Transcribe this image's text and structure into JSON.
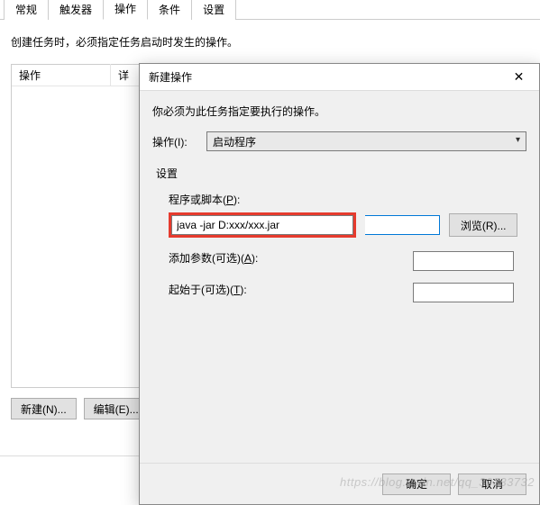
{
  "bgWindow": {
    "tabs": [
      "常规",
      "触发器",
      "操作",
      "条件",
      "设置"
    ],
    "activeTab": 2,
    "desc": "创建任务时，必须指定任务启动时发生的操作。",
    "listHeader": {
      "col1": "操作",
      "col2": "详"
    },
    "buttons": {
      "new": "新建(N)...",
      "edit": "编辑(E)..."
    }
  },
  "dialog": {
    "title": "新建操作",
    "desc": "你必须为此任务指定要执行的操作。",
    "actionLabel": "操作(I):",
    "actionValue": "启动程序",
    "settingsLabel": "设置",
    "progLabelPrefix": "程序或脚本(",
    "progLabelKey": "P",
    "progLabelSuffix": "):",
    "progValue": "java -jar D:xxx/xxx.jar",
    "browse": "浏览(R)...",
    "argsLabelPrefix": "添加参数(可选)(",
    "argsLabelKey": "A",
    "argsLabelSuffix": "):",
    "argsValue": "",
    "startInLabelPrefix": "起始于(可选)(",
    "startInLabelKey": "T",
    "startInLabelSuffix": "):",
    "startInValue": "",
    "ok": "确定",
    "cancel": "取消"
  },
  "watermark": "https://blog.csdn.net/qq_33333732"
}
